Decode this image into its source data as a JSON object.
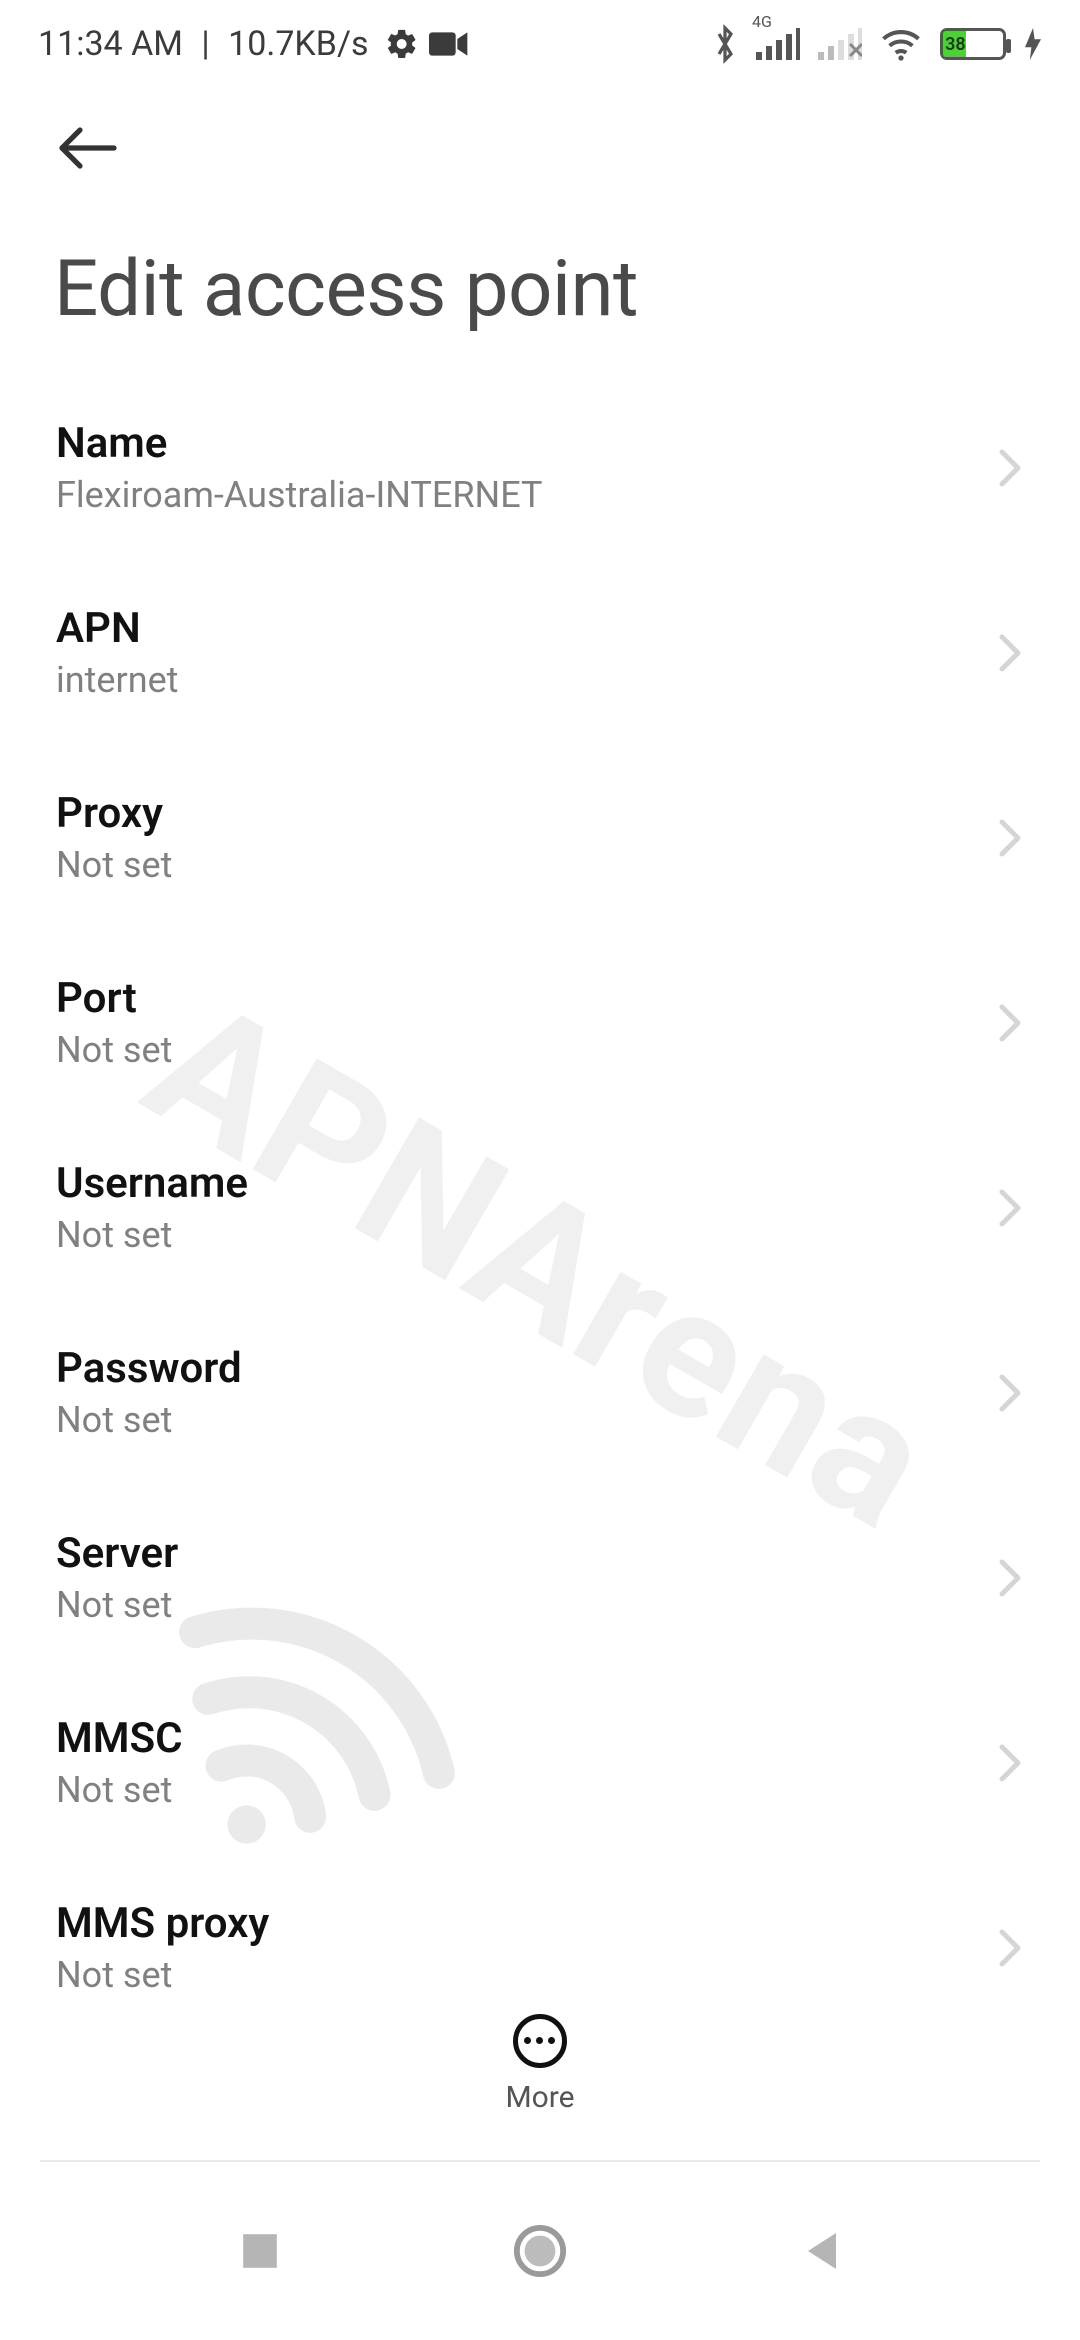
{
  "status": {
    "time": "11:34 AM",
    "netspeed": "10.7KB/s",
    "battery_pct": 38,
    "network_label": "4G"
  },
  "header": {
    "title": "Edit access point"
  },
  "rows": [
    {
      "label": "Name",
      "value": "Flexiroam-Australia-INTERNET"
    },
    {
      "label": "APN",
      "value": "internet"
    },
    {
      "label": "Proxy",
      "value": "Not set"
    },
    {
      "label": "Port",
      "value": "Not set"
    },
    {
      "label": "Username",
      "value": "Not set"
    },
    {
      "label": "Password",
      "value": "Not set"
    },
    {
      "label": "Server",
      "value": "Not set"
    },
    {
      "label": "MMSC",
      "value": "Not set"
    },
    {
      "label": "MMS proxy",
      "value": "Not set"
    }
  ],
  "bottom": {
    "more_label": "More"
  },
  "watermark": "APNArena"
}
